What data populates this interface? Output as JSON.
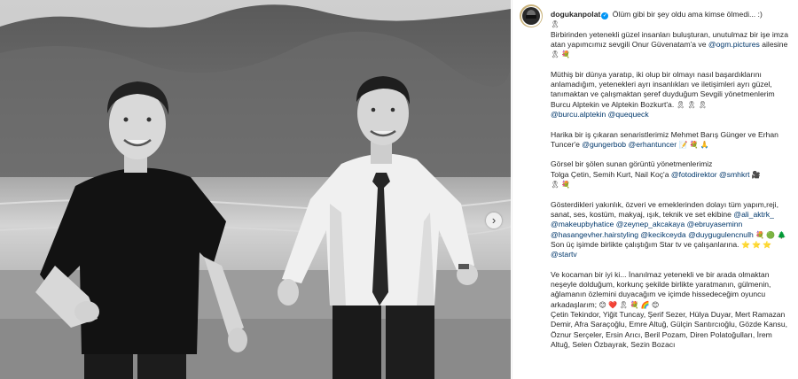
{
  "post": {
    "username": "dogukanpolat",
    "intro": "Ölüm gibi bir şey oldu ama kimse ölmedi... :)",
    "intro_emoji": "🎗"
  },
  "caption": {
    "p1": {
      "text": "Birbirinden yetenekli güzel insanları buluşturan, unutulmaz bir işe imza atan yapımcımız sevgili Onur Güvenatam'a ve",
      "mention": "@ogm.pictures",
      "tail": "ailesine",
      "emoji": "🎗 💐"
    },
    "p2": {
      "text": "Müthiş bir dünya yaratıp, iki olup bir olmayı nasıl başardıklarını anlamadığım, yetenekleri ayrı insanlıkları ve iletişimleri ayrı güzel, tanımaktan ve çalışmaktan şeref duyduğum Sevgili yönetmenlerim Burcu Alptekin ve Alptekin Bozkurt'a.",
      "emoji": "🎗 🎗 🎗",
      "mentions": [
        "@burcu.alptekin",
        "@quequeck"
      ]
    },
    "p3": {
      "text": "Harika bir iş çıkaran senaristlerimiz Mehmet Barış Günger ve Erhan Tuncer'e",
      "mentions": [
        "@gungerbob",
        "@erhantuncer"
      ],
      "emoji": "📝 💐 🙏"
    },
    "p4": {
      "text1": "Görsel bir şölen sunan görüntü yönetmenlerimiz",
      "text2": "Tolga Çetin, Semih Kurt, Nail Koç'a",
      "mentions": [
        "@fotodirektor",
        "@smhkrt"
      ],
      "emoji_after": "🎥",
      "emoji_line": "🎗 💐"
    },
    "p5": {
      "text": "Gösterdikleri yakınlık, özveri ve emeklerinden dolayı tüm yapım,reji, sanat, ses, kostüm, makyaj, ışık, teknik ve set ekibine",
      "mentions_line1": [
        "@ali_aktrk_",
        "@makeupbyhatice",
        "@zeynep_akcakaya"
      ],
      "mentions_line2": [
        "@ebruyaseminn",
        "@hasangevher.hairstyling",
        "@kecikceyda"
      ],
      "mentions_line3": [
        "@duygugulencnulh"
      ],
      "emoji_line3": "💐 🟢 🌲",
      "star_text": "Son üç işimde birlikte çalıştığım Star tv ve çalışanlarına.",
      "star_emoji": "⭐ ⭐ ⭐",
      "star_mention": "@startv"
    },
    "p6": {
      "text": "Ve kocaman bir iyi ki... İnanılmaz yetenekli ve bir arada olmaktan neşeyle dolduğum, korkunç şekilde birlikte yaratmanın, gülmenin, ağlamanın özlemini duyacağım ve içimde hissedeceğim oyuncu arkadaşlarım;",
      "emoji": "😊 ❤️ 🎗 💐 🌈 😊",
      "cast": "Çetin Tekindor, Yiğit Tuncay, Şerif Sezer, Hülya Duyar, Mert Ramazan Demir, Afra Saraçoğlu, Emre Altuğ, Gülçin Santırcıoğlu, Gözde Kansu, Öznur Serçeler, Ersin Arıcı, Beril Pozam, Diren Polatoğulları, İrem Altuğ, Selen Özbayrak, Sezin Bozacı"
    }
  },
  "ui": {
    "next_arrow": "›",
    "verified_mark": "✓"
  },
  "colors": {
    "link": "#00376b",
    "text": "#262626",
    "verified": "#0095f6",
    "avatar_ring": "#c9b27a"
  },
  "icons": [
    "verified-badge-icon",
    "chevron-right-icon",
    "avatar"
  ]
}
